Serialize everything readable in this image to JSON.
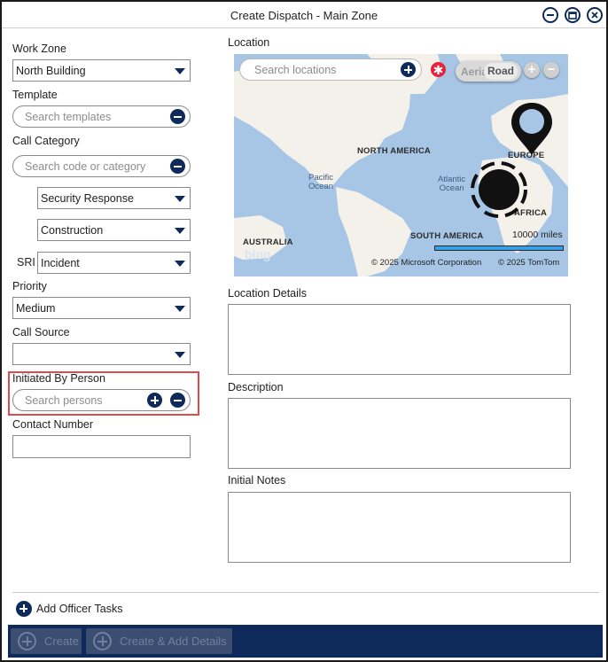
{
  "window": {
    "title": "Create Dispatch - Main Zone"
  },
  "left": {
    "work_zone": {
      "label": "Work Zone",
      "value": "North Building"
    },
    "template": {
      "label": "Template",
      "placeholder": "Search templates"
    },
    "call_category": {
      "label": "Call Category",
      "placeholder": "Search code or category",
      "level1": "Security Response",
      "level2": "Construction",
      "sri_label": "SRI",
      "sri_value": "Incident"
    },
    "priority": {
      "label": "Priority",
      "value": "Medium"
    },
    "call_source": {
      "label": "Call Source",
      "value": ""
    },
    "initiated_by": {
      "label": "Initiated By Person",
      "placeholder": "Search persons"
    },
    "contact": {
      "label": "Contact Number",
      "value": ""
    }
  },
  "right": {
    "location": {
      "label": "Location",
      "search_placeholder": "Search locations",
      "map": {
        "view_aerial": "Aerial",
        "view_road": "Road",
        "labels": {
          "north_america": "NORTH AMERICA",
          "europe": "EUROPE",
          "africa": "AFRICA",
          "south_america": "SOUTH AMERICA",
          "australia": "AUSTRALIA",
          "pacific": "Pacific",
          "pacific2": "Ocean",
          "atlantic": "Atlantic",
          "atlantic2": "Ocean"
        },
        "scale": "10000 miles",
        "copyright_ms": "© 2025 Microsoft Corporation",
        "copyright_tt": "© 2025 TomTom",
        "bing_logo": "bing"
      }
    },
    "location_details": {
      "label": "Location Details"
    },
    "description": {
      "label": "Description"
    },
    "initial_notes": {
      "label": "Initial Notes"
    }
  },
  "add_officer_tasks": "Add Officer Tasks",
  "footer": {
    "create": "Create",
    "create_add": "Create & Add Details"
  },
  "colors": {
    "accent": "#0e2a5a",
    "highlight": "#e04a4a",
    "clear_red": "#e8203a",
    "map_water": "#a7c6e6"
  },
  "icons": [
    "minimize-icon",
    "restore-icon",
    "close-icon",
    "chevron-down-icon",
    "plus-circle-icon",
    "minus-circle-icon",
    "map-pin-icon",
    "target-marker-icon",
    "clear-icon"
  ]
}
